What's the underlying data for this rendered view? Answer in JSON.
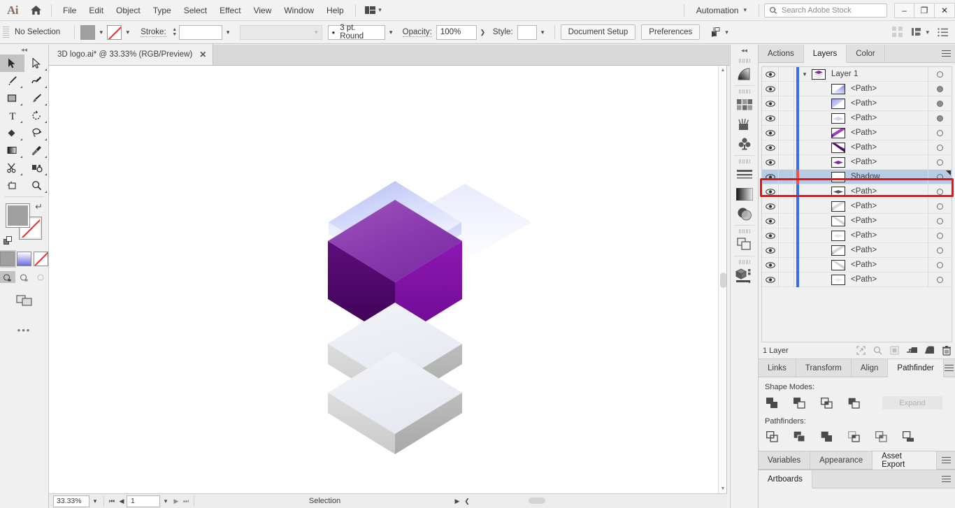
{
  "app": {
    "logo": "Ai",
    "home_icon": "home-icon"
  },
  "menubar": {
    "items": [
      "File",
      "Edit",
      "Object",
      "Type",
      "Select",
      "Effect",
      "View",
      "Window",
      "Help"
    ],
    "arrange_icon": "arrange-documents-icon",
    "workspace": "Automation",
    "search_placeholder": "Search Adobe Stock",
    "search_value": "",
    "search_icon": "search-icon",
    "window_buttons": {
      "minimize": "–",
      "restore": "❐",
      "close": "✕"
    }
  },
  "controlbar": {
    "selection_status": "No Selection",
    "fill_label": "fill-swatch",
    "stroke_swatch_label": "stroke-swatch-none",
    "stroke_label": "Stroke:",
    "stroke_weight": "",
    "stroke_profile": "",
    "brush_definition": "3 pt. Round",
    "opacity_label": "Opacity:",
    "opacity_value": "100%",
    "style_label": "Style:",
    "style_value": "",
    "document_setup": "Document Setup",
    "preferences": "Preferences",
    "align_icon": "align-to-selection-icon",
    "arrange_icon": "arrange-objects-icon",
    "grid_icon": "grid-view-icon",
    "list_icon": "list-view-icon"
  },
  "document_tab": {
    "title": "3D logo.ai* @ 33.33% (RGB/Preview)",
    "close": "✕"
  },
  "toolbar": {
    "tools": [
      {
        "name": "selection-tool",
        "active": true,
        "group": false
      },
      {
        "name": "direct-selection-tool",
        "active": false,
        "group": true
      },
      {
        "name": "pen-tool",
        "active": false,
        "group": true
      },
      {
        "name": "curvature-tool",
        "active": false,
        "group": true
      },
      {
        "name": "rectangle-tool",
        "active": false,
        "group": true
      },
      {
        "name": "paintbrush-tool",
        "active": false,
        "group": true
      },
      {
        "name": "type-tool",
        "active": false,
        "group": true
      },
      {
        "name": "rotate-tool",
        "active": false,
        "group": true
      },
      {
        "name": "shape-builder-tool",
        "active": false,
        "group": true
      },
      {
        "name": "lasso-tool",
        "active": false,
        "group": true
      },
      {
        "name": "gradient-tool",
        "active": false,
        "group": true
      },
      {
        "name": "eyedropper-tool",
        "active": false,
        "group": true
      },
      {
        "name": "scissors-tool",
        "active": false,
        "group": true
      },
      {
        "name": "blend-tool",
        "active": false,
        "group": true
      },
      {
        "name": "artboard-tool",
        "active": false,
        "group": false
      },
      {
        "name": "zoom-tool",
        "active": false,
        "group": true
      }
    ],
    "fill_color": "#a0a0a0",
    "stroke_color": "none",
    "swap_icon": "swap-fill-stroke-icon",
    "default_icon": "default-fill-stroke-icon",
    "paint_modes": [
      "color-mode",
      "gradient-mode",
      "none-mode"
    ],
    "paint_mode_selected": 0,
    "draw_modes": [
      "draw-normal",
      "draw-behind",
      "draw-inside"
    ],
    "draw_mode_selected": 0,
    "screen_mode_icon": "change-screen-mode-icon",
    "more_icon": "edit-toolbar-icon"
  },
  "statusbar": {
    "zoom": "33.33%",
    "page": "1",
    "status_text": "Selection",
    "first_icon": "first-artboard-icon",
    "prev_icon": "previous-artboard-icon",
    "next_icon": "next-artboard-icon",
    "last_icon": "last-artboard-icon"
  },
  "rail": {
    "collapse_icon": "collapse-panels-icon",
    "icons": [
      "gradient-panel-icon",
      "swatches-panel-icon",
      "brushes-panel-icon",
      "symbols-panel-icon",
      "stroke-panel-icon",
      "gradient2-panel-icon",
      "transparency-panel-icon",
      "pathfinder-panel-icon",
      "3d-panel-icon"
    ]
  },
  "layers_panel": {
    "tabs": [
      {
        "label": "Actions",
        "active": false
      },
      {
        "label": "Layers",
        "active": true
      },
      {
        "label": "Color",
        "active": false
      }
    ],
    "menu_icon": "panel-menu-icon",
    "rows": [
      {
        "name": "Layer 1",
        "type": "layer",
        "visible": true,
        "selected": false,
        "target_filled": false,
        "twisty": true,
        "thumb": "layer-stack-thumb"
      },
      {
        "name": "<Path>",
        "type": "path",
        "visible": true,
        "selected": false,
        "target_filled": true,
        "twisty": false,
        "thumb": "path-blue-gradient-thumb"
      },
      {
        "name": "<Path>",
        "type": "path",
        "visible": true,
        "selected": false,
        "target_filled": true,
        "twisty": false,
        "thumb": "path-blue-diag-thumb"
      },
      {
        "name": "<Path>",
        "type": "path",
        "visible": true,
        "selected": false,
        "target_filled": true,
        "twisty": false,
        "thumb": "path-pale-diamond-thumb"
      },
      {
        "name": "<Path>",
        "type": "path",
        "visible": true,
        "selected": false,
        "target_filled": false,
        "twisty": false,
        "thumb": "path-purple-diag-thumb"
      },
      {
        "name": "<Path>",
        "type": "path",
        "visible": true,
        "selected": false,
        "target_filled": false,
        "twisty": false,
        "thumb": "path-darkpurple-diag-thumb"
      },
      {
        "name": "<Path>",
        "type": "path",
        "visible": true,
        "selected": false,
        "target_filled": false,
        "twisty": false,
        "thumb": "path-purple-diamond-thumb"
      },
      {
        "name": "Shadow",
        "type": "path",
        "visible": true,
        "selected": true,
        "target_filled": false,
        "twisty": false,
        "thumb": "path-white-thumb"
      },
      {
        "name": "<Path>",
        "type": "path",
        "visible": true,
        "selected": false,
        "target_filled": false,
        "twisty": false,
        "thumb": "path-gray-diamond-thumb"
      },
      {
        "name": "<Path>",
        "type": "path",
        "visible": true,
        "selected": false,
        "target_filled": false,
        "twisty": false,
        "thumb": "path-gray-diag-thumb"
      },
      {
        "name": "<Path>",
        "type": "path",
        "visible": true,
        "selected": false,
        "target_filled": false,
        "twisty": false,
        "thumb": "path-lightgray-diag-thumb"
      },
      {
        "name": "<Path>",
        "type": "path",
        "visible": true,
        "selected": false,
        "target_filled": false,
        "twisty": false,
        "thumb": "path-pale-diamond2-thumb"
      },
      {
        "name": "<Path>",
        "type": "path",
        "visible": true,
        "selected": false,
        "target_filled": false,
        "twisty": false,
        "thumb": "path-gray-diag2-thumb"
      },
      {
        "name": "<Path>",
        "type": "path",
        "visible": true,
        "selected": false,
        "target_filled": false,
        "twisty": false,
        "thumb": "path-lightgray-diag2-thumb"
      },
      {
        "name": "<Path>",
        "type": "path",
        "visible": true,
        "selected": false,
        "target_filled": false,
        "twisty": false,
        "thumb": "path-pale-diamond3-thumb"
      }
    ],
    "footer_count": "1 Layer",
    "footer_icons": [
      "locate-object-icon",
      "make-clipping-mask-icon",
      "release-clipping-icon",
      "create-sublayer-icon",
      "create-new-layer-icon",
      "delete-selection-icon"
    ],
    "highlight_color": "#ee1111",
    "selection_color": "#b6cce4"
  },
  "pathfinder_panel": {
    "tabs": [
      {
        "label": "Links",
        "active": false
      },
      {
        "label": "Transform",
        "active": false
      },
      {
        "label": "Align",
        "active": false
      },
      {
        "label": "Pathfinder",
        "active": true
      }
    ],
    "menu_icon": "panel-menu-icon",
    "shape_modes_label": "Shape Modes:",
    "shape_modes": [
      "unite-icon",
      "minus-front-icon",
      "intersect-icon",
      "exclude-icon"
    ],
    "expand_label": "Expand",
    "pathfinders_label": "Pathfinders:",
    "pathfinders": [
      "divide-icon",
      "trim-icon",
      "merge-icon",
      "crop-icon",
      "outline-icon",
      "minus-back-icon"
    ]
  },
  "bottom_panel": {
    "tabs": [
      {
        "label": "Variables",
        "active": false
      },
      {
        "label": "Appearance",
        "active": false
      },
      {
        "label": "Asset Export",
        "active": true
      }
    ],
    "menu_icon": "panel-menu-icon"
  },
  "artboards_panel": {
    "tabs": [
      {
        "label": "Artboards",
        "active": true
      }
    ],
    "menu_icon": "panel-menu-icon"
  },
  "artwork": {
    "name": "3d-layered-logo",
    "description": "Isometric stacked 3D logo: translucent blue top plate, purple cube, two gray plates",
    "colors": {
      "top_plate": "#b9c0f5",
      "cube_top": "#8e3fb0",
      "cube_left": "#4a0a62",
      "cube_right": "#7a0f9e",
      "plate_top": "#eceef5",
      "plate_left": "#d8d8d8",
      "plate_right": "#b5b5b5"
    }
  }
}
